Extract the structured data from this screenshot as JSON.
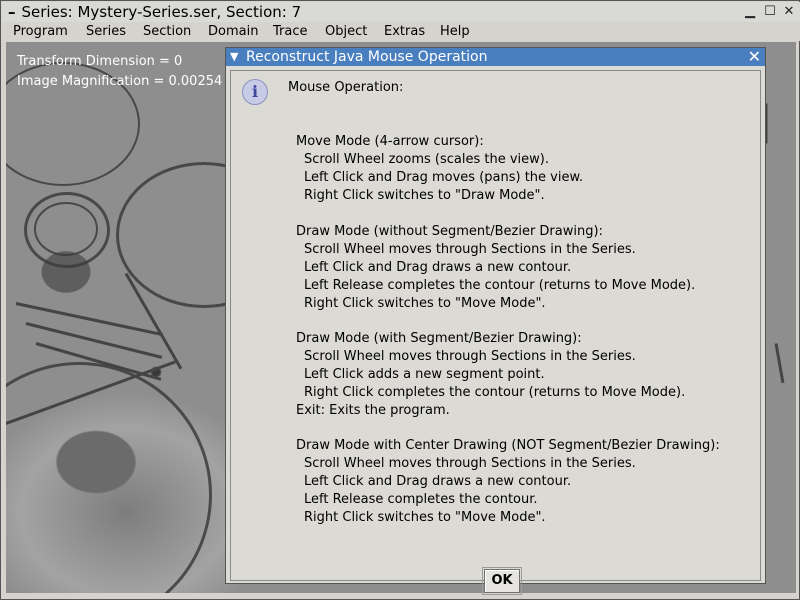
{
  "window": {
    "title": "Series: Mystery-Series.ser, Section: 7",
    "controls": [
      "minimize-icon",
      "maximize-icon",
      "close-icon"
    ]
  },
  "menubar": {
    "items": [
      "Program",
      "Series",
      "Section",
      "Domain",
      "Trace",
      "Object",
      "Extras",
      "Help"
    ]
  },
  "overlay": {
    "transform_dimension": "Transform Dimension = 0",
    "image_magnification": "Image Magnification = 0.00254"
  },
  "dialog": {
    "title": "Reconstruct Java Mouse Operation",
    "icon": "info-icon",
    "heading": "Mouse Operation:",
    "lines": [
      "Move Mode (4-arrow cursor):",
      "Scroll Wheel zooms (scales the view).",
      "Left Click and Drag moves (pans) the view.",
      "Right Click switches to \"Draw Mode\".",
      "Draw Mode (without Segment/Bezier Drawing):",
      "Scroll Wheel moves through Sections in the Series.",
      "Left Click and Drag draws a new contour.",
      "Left Release completes the contour (returns to Move Mode).",
      "Right Click switches to \"Move Mode\".",
      "Draw Mode (with Segment/Bezier Drawing):",
      "Scroll Wheel moves through Sections in the Series.",
      "Left Click adds a new segment point.",
      "Right Click completes the contour (returns to Move Mode).",
      "Exit: Exits the program.",
      "Draw Mode with Center Drawing (NOT Segment/Bezier Drawing):",
      "Scroll Wheel moves through Sections in the Series.",
      "Left Click and Drag draws a new contour.",
      "Left Release completes the contour.",
      "Right Click switches to \"Move Mode\"."
    ],
    "ok_label": "OK"
  },
  "colors": {
    "dialog_title_bar": "#4a7fbf",
    "dialog_background": "#dcdad5",
    "window_chrome": "#d6d3ce"
  }
}
